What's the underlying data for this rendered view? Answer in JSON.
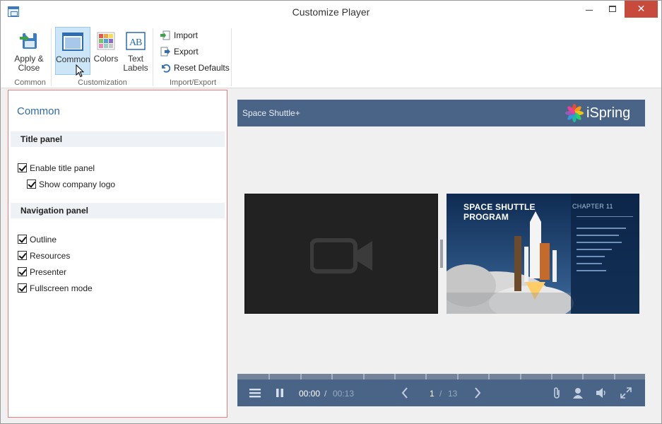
{
  "window": {
    "title": "Customize Player",
    "close_glyph": "✕"
  },
  "ribbon": {
    "apply_label": "Apply & Close",
    "common_label": "Common",
    "colors_label": "Colors",
    "text_labels_label": "Text Labels",
    "import_label": "Import",
    "export_label": "Export",
    "reset_label": "Reset Defaults",
    "groups": {
      "common": "Common",
      "customization": "Customization",
      "import_export": "Import/Export"
    }
  },
  "panel": {
    "heading": "Common",
    "title_panel": {
      "header": "Title panel",
      "options": [
        {
          "label": "Enable title panel",
          "checked": true
        },
        {
          "label": "Show company logo",
          "checked": true
        }
      ]
    },
    "navigation_panel": {
      "header": "Navigation panel",
      "options": [
        {
          "label": "Outline",
          "checked": true
        },
        {
          "label": "Resources",
          "checked": true
        },
        {
          "label": "Presenter",
          "checked": true
        },
        {
          "label": "Fullscreen mode",
          "checked": true
        }
      ]
    }
  },
  "player": {
    "title": "Space Shuttle+",
    "logo_text": "iSpring",
    "time_current": "00:00",
    "time_separator": "/",
    "time_total": "00:13",
    "page_current": "1",
    "page_separator": "/",
    "page_total": "13",
    "slide": {
      "title_line1": "SPACE SHUTTLE",
      "title_line2": "PROGRAM",
      "chapter": "CHAPTER 11"
    }
  },
  "colors": {
    "accent": "#2f6ca8",
    "player_bar": "#4a6487",
    "selection_border": "#e57d86",
    "close_button": "#c74a3c"
  },
  "icons": {
    "apply": "save-close-icon",
    "common": "layout-icon",
    "colors": "color-palette-icon",
    "text_labels": "text-ab-icon",
    "import": "import-icon",
    "export": "export-icon",
    "reset": "reset-icon"
  }
}
